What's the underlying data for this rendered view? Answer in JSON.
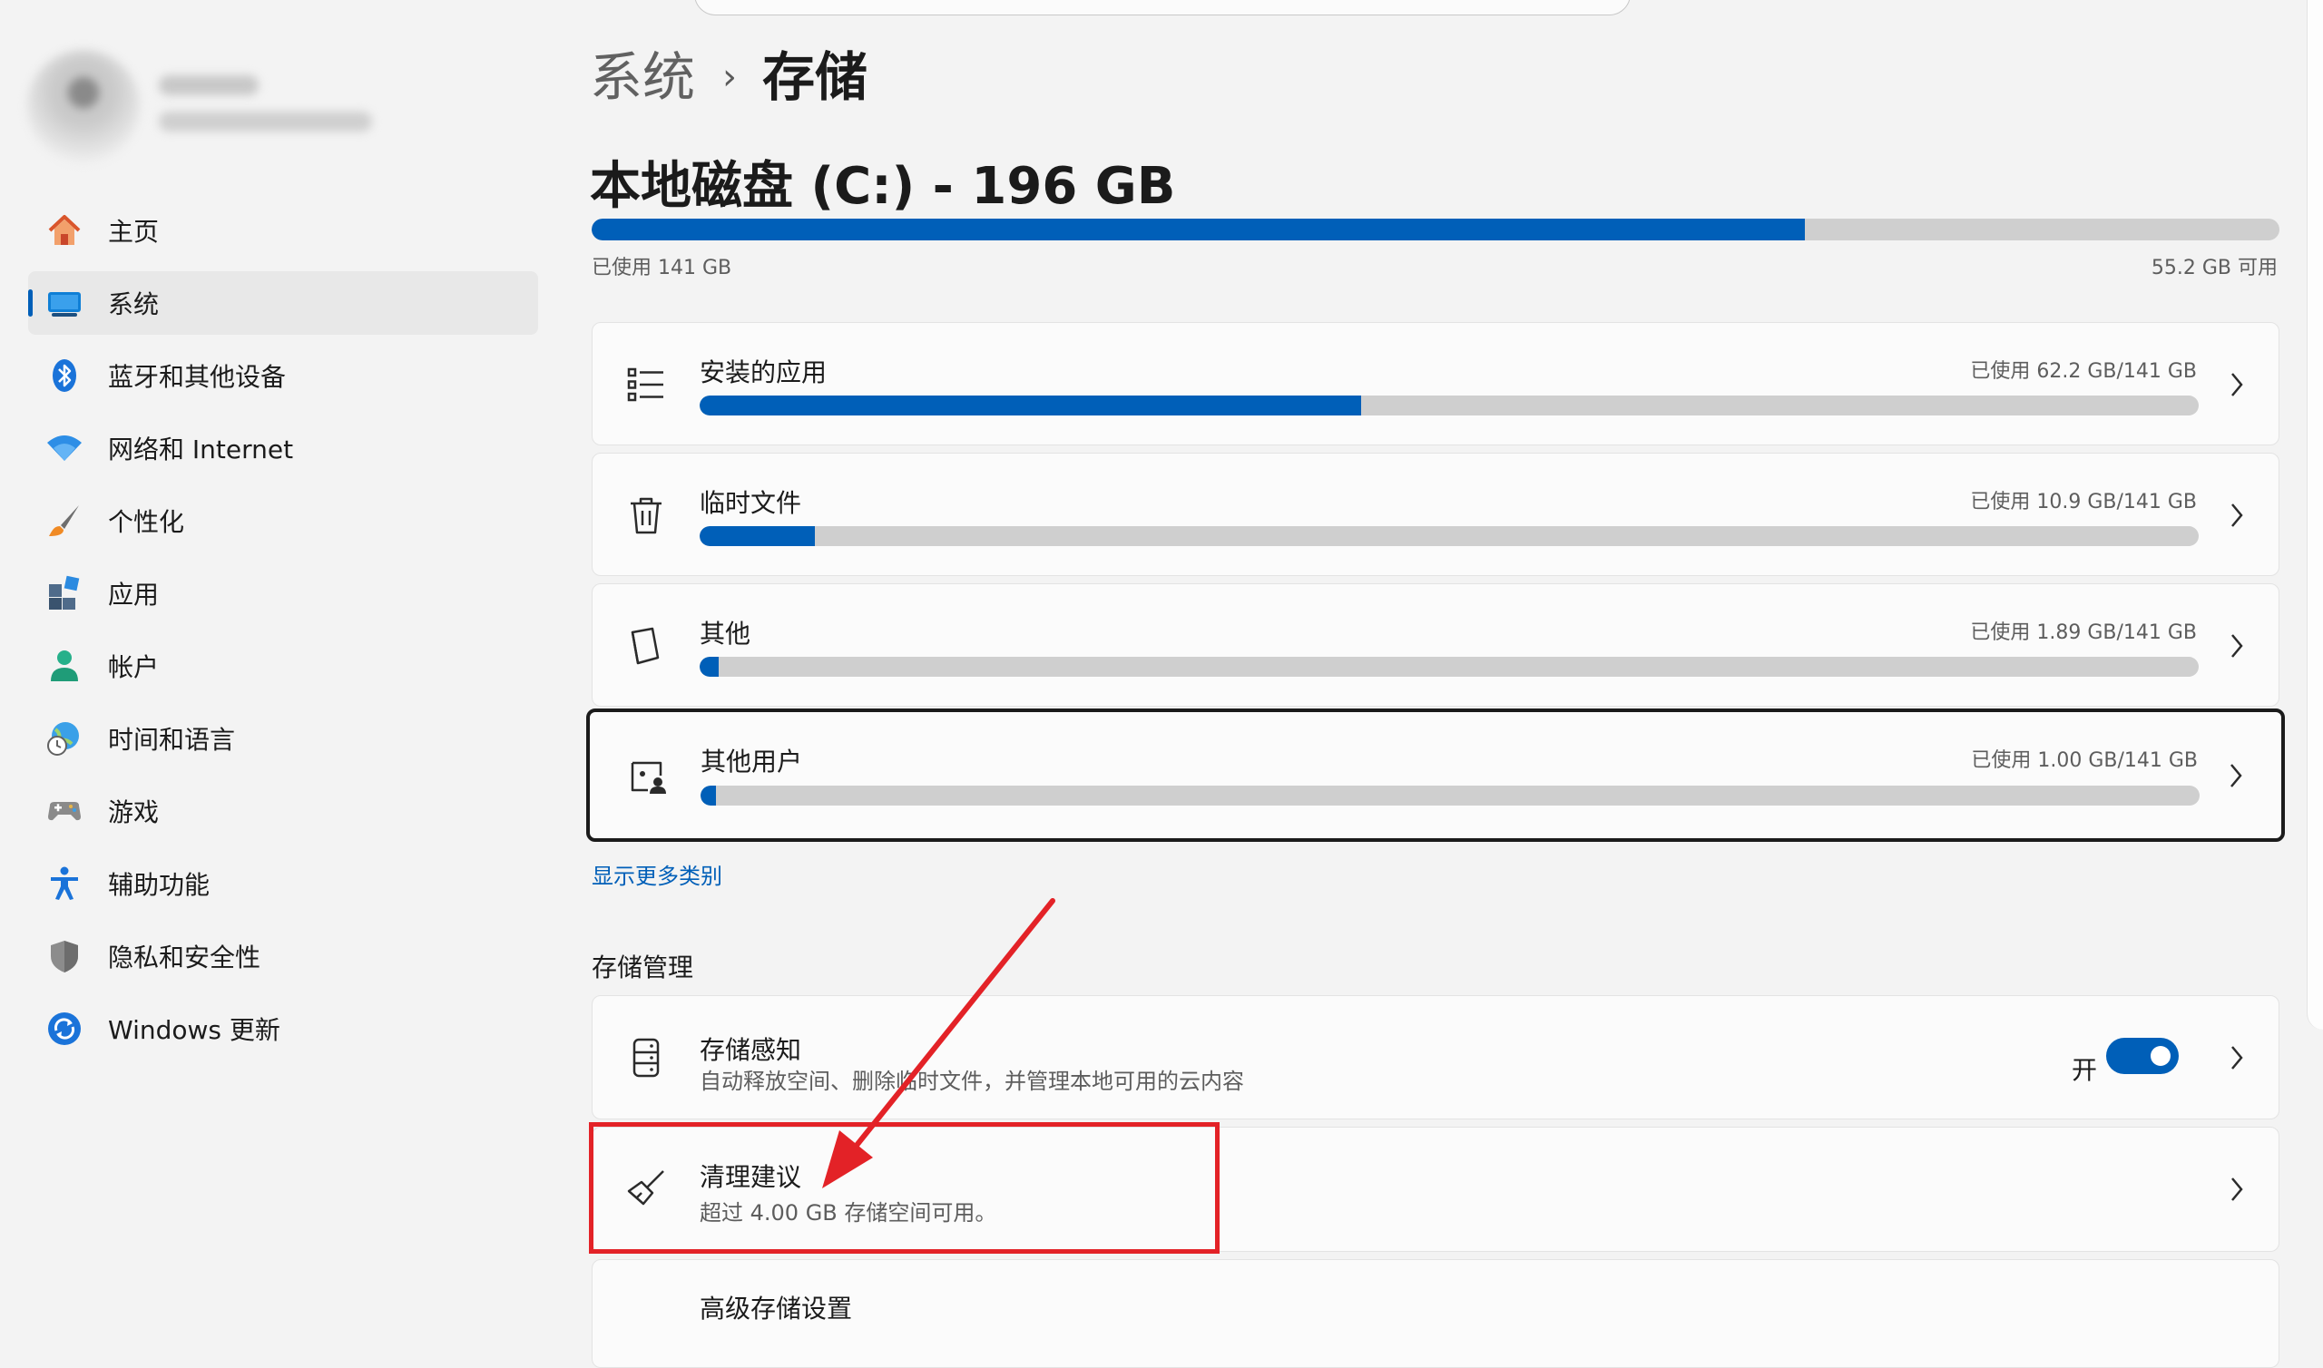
{
  "breadcrumb": {
    "parent": "系统",
    "separator": "›",
    "current": "存储"
  },
  "sidebar": {
    "items": [
      {
        "label": "主页",
        "icon": "home-icon"
      },
      {
        "label": "系统",
        "icon": "system-display-icon",
        "selected": true
      },
      {
        "label": "蓝牙和其他设备",
        "icon": "bluetooth-icon"
      },
      {
        "label": "网络和 Internet",
        "icon": "wifi-icon"
      },
      {
        "label": "个性化",
        "icon": "brush-icon"
      },
      {
        "label": "应用",
        "icon": "apps-icon"
      },
      {
        "label": "帐户",
        "icon": "account-icon"
      },
      {
        "label": "时间和语言",
        "icon": "globe-clock-icon"
      },
      {
        "label": "游戏",
        "icon": "gamepad-icon"
      },
      {
        "label": "辅助功能",
        "icon": "accessibility-icon"
      },
      {
        "label": "隐私和安全性",
        "icon": "shield-icon"
      },
      {
        "label": "Windows 更新",
        "icon": "windows-update-icon"
      }
    ]
  },
  "disk": {
    "title": "本地磁盘 (C:) - 196 GB",
    "used_label": "已使用 141 GB",
    "free_label": "55.2 GB 可用",
    "used_fraction": 0.719
  },
  "categories": [
    {
      "title": "安装的应用",
      "usage": "已使用 62.2 GB/141 GB",
      "fraction": 0.441,
      "icon": "list-icon"
    },
    {
      "title": "临时文件",
      "usage": "已使用 10.9 GB/141 GB",
      "fraction": 0.077,
      "icon": "trash-icon"
    },
    {
      "title": "其他",
      "usage": "已使用 1.89 GB/141 GB",
      "fraction": 0.013,
      "icon": "document-icon"
    },
    {
      "title": "其他用户",
      "usage": "已使用 1.00 GB/141 GB",
      "fraction": 0.007,
      "icon": "user-folder-icon"
    }
  ],
  "show_more_link": "显示更多类别",
  "management": {
    "section_title": "存储管理",
    "storage_sense": {
      "title": "存储感知",
      "subtitle": "自动释放空间、删除临时文件，并管理本地可用的云内容",
      "toggle_label": "开",
      "toggle_on": true,
      "icon": "storage-drive-icon"
    },
    "cleanup": {
      "title": "清理建议",
      "subtitle": "超过 4.00 GB 存储空间可用。",
      "icon": "broom-icon"
    },
    "advanced": {
      "title": "高级存储设置"
    }
  },
  "colors": {
    "accent": "#005fb8",
    "annotation": "#e32227",
    "track": "#cfcfcf"
  }
}
